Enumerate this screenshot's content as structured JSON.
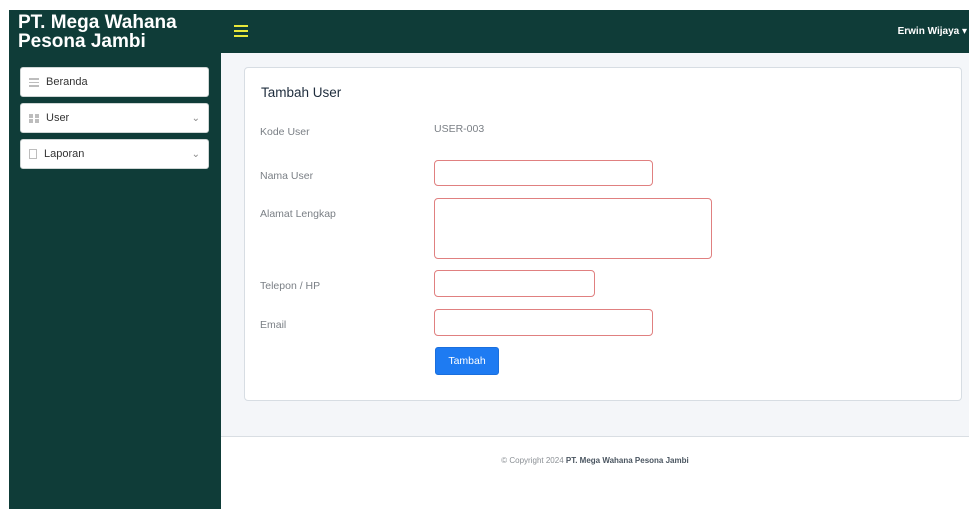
{
  "brand": {
    "line1": "PT. Mega Wahana",
    "line2": "Pesona Jambi"
  },
  "header": {
    "user_name": "Erwin Wijaya ▾",
    "menu_icon": "hamburger-icon"
  },
  "sidebar": {
    "items": [
      {
        "label": "Beranda",
        "icon": "list-icon",
        "chevron": ""
      },
      {
        "label": "User",
        "icon": "grid-icon",
        "chevron": "⌄"
      },
      {
        "label": "Laporan",
        "icon": "document-icon",
        "chevron": "⌄"
      }
    ]
  },
  "form": {
    "title": "Tambah User",
    "kode_label": "Kode User",
    "kode_value": "USER-003",
    "nama_label": "Nama User",
    "nama_value": "",
    "alamat_label": "Alamat Lengkap",
    "alamat_value": "",
    "telepon_label": "Telepon / HP",
    "telepon_value": "",
    "email_label": "Email",
    "email_value": "",
    "submit_label": "Tambah"
  },
  "footer": {
    "prefix": "© Copyright 2024",
    "company": "PT. Mega Wahana Pesona Jambi"
  },
  "colors": {
    "sidebar_bg": "#0f3c38",
    "accent": "#e8e83a",
    "primary_button": "#1e7bf2",
    "invalid_border": "#e08080"
  }
}
